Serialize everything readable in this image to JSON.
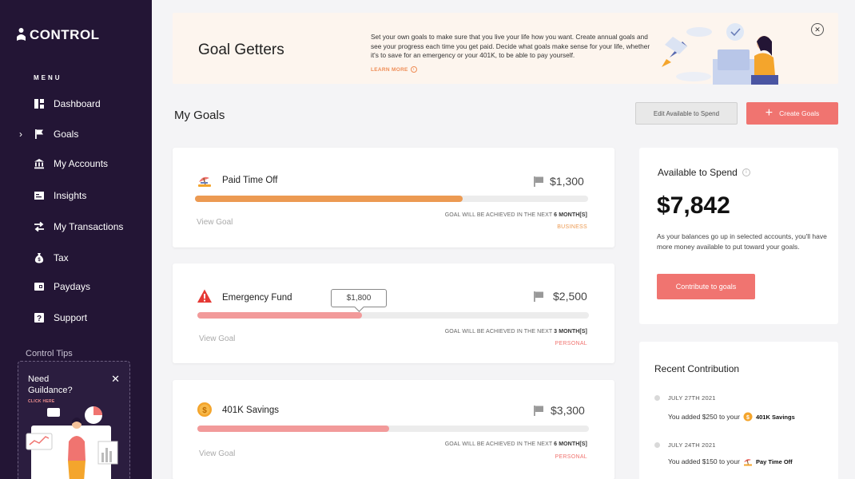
{
  "brand": {
    "name": "CONTROL"
  },
  "sidebar": {
    "menu_title": "MENU",
    "items": [
      {
        "label": "Dashboard",
        "icon": "dashboard-icon"
      },
      {
        "label": "Goals",
        "icon": "flag-icon",
        "active": true
      },
      {
        "label": "My Accounts",
        "icon": "bank-icon"
      },
      {
        "label": "Insights",
        "icon": "insights-icon"
      },
      {
        "label": "My Transactions",
        "icon": "transfer-icon"
      },
      {
        "label": "Tax",
        "icon": "money-bag-icon"
      },
      {
        "label": "Paydays",
        "icon": "wallet-icon"
      },
      {
        "label": "Support",
        "icon": "help-icon"
      }
    ],
    "tips": {
      "title": "Control Tips",
      "card_title": "Need Guildance?",
      "click_here": "CLICK HERE"
    }
  },
  "banner": {
    "title": "Goal Getters",
    "description": "Set your own goals to make sure that you live your life how you want. Create annual goals and see your progress each time you get paid. Decide what goals make sense for your life, whether it's to save for an emergency or your 401K, to be able to pay yourself.",
    "learn_more": "LEARN MORE"
  },
  "header": {
    "title": "My Goals",
    "edit_label": "Edit Available to Spend",
    "create_label": "Create Goals"
  },
  "goals": [
    {
      "name": "Paid Time Off",
      "amount": "$1,300",
      "progress": 0.68,
      "fill_color": "#ec9a52",
      "view_label": "View Goal",
      "achieve_prefix": "GOAL WILL BE ACHIEVED IN THE NEXT",
      "achieve_value": "6 MONTH[S]",
      "category": "BUSINESS",
      "category_color": "#ec9a52"
    },
    {
      "name": "Emergency Fund",
      "amount": "$2,500",
      "progress": 0.42,
      "fill_color": "#f29a9a",
      "tooltip": "$1,800",
      "view_label": "View Goal",
      "achieve_prefix": "GOAL WILL BE ACHIEVED IN THE NEXT",
      "achieve_value": "3 MONTH[S]",
      "category": "PERSONAL",
      "category_color": "#f07470"
    },
    {
      "name": "401K Savings",
      "amount": "$3,300",
      "progress": 0.49,
      "fill_color": "#f29a9a",
      "view_label": "View Goal",
      "achieve_prefix": "GOAL WILL BE ACHIEVED IN THE NEXT",
      "achieve_value": "6 MONTH[S]",
      "category": "PERSONAL",
      "category_color": "#f07470"
    }
  ],
  "available": {
    "title": "Available to Spend",
    "amount": "$7,842",
    "description": "As your balances go up in selected accounts, you'll have more money available to put toward your goals.",
    "button": "Contribute to goals"
  },
  "recent": {
    "title": "Recent Contribution",
    "items": [
      {
        "date": "JULY 27TH 2021",
        "text": "You added $250 to your",
        "goal": "401K Savings",
        "icon": "coin-icon"
      },
      {
        "date": "JULY 24TH 2021",
        "text": "You added $150 to your",
        "goal": "Pay Time Off",
        "icon": "beach-icon"
      }
    ]
  }
}
